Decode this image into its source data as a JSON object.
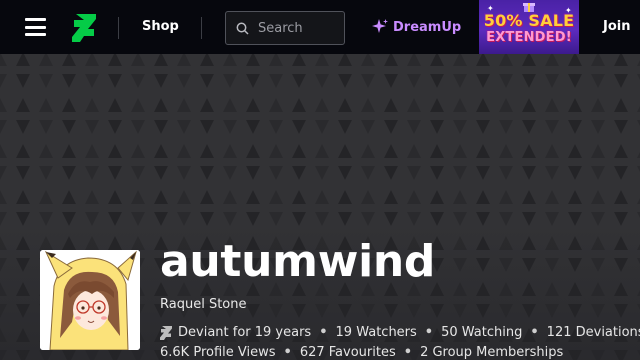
{
  "header": {
    "menu_icon": "hamburger-menu-icon",
    "logo_icon": "deviantart-logo-icon",
    "shop_label": "Shop",
    "search": {
      "placeholder": "Search",
      "value": ""
    },
    "dreamup_label": "DreamUp",
    "promo": {
      "line1": "50% SALE",
      "line2": "EXTENDED!"
    },
    "join_label": "Join",
    "accent_color": "#05cc47",
    "dreamup_color": "#c98cff"
  },
  "profile": {
    "username": "autumwind",
    "real_name": "Raquel Stone",
    "deviant_for": "Deviant for 19 years",
    "watchers": "19 Watchers",
    "watching": "50 Watching",
    "deviations": "121 Deviations",
    "profile_views": "6.6K Profile Views",
    "favourites": "627 Favourites",
    "group_memberships": "2 Group Memberships"
  }
}
